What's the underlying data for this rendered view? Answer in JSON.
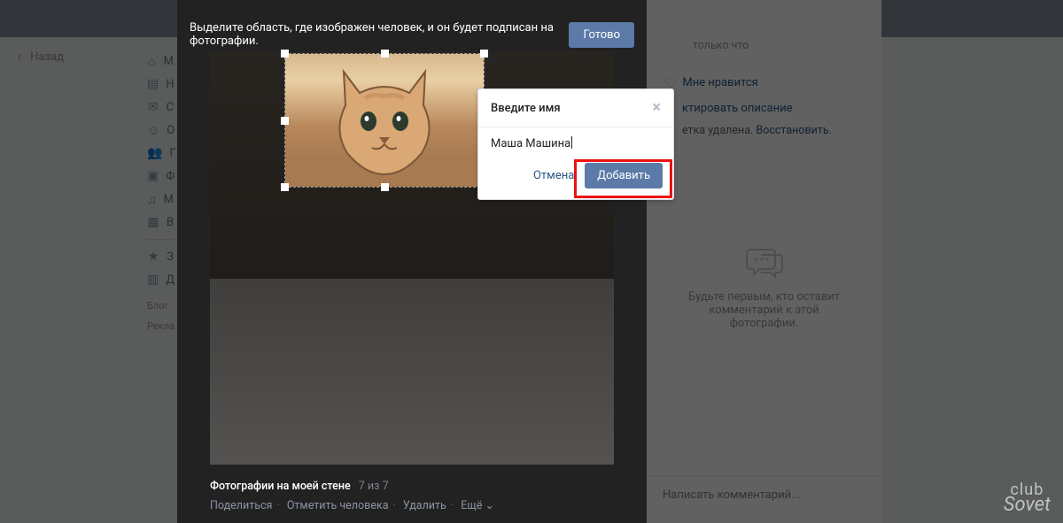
{
  "nav": {
    "back": "Назад"
  },
  "sidebar": {
    "items": [
      "М",
      "Н",
      "С",
      "О",
      "Г",
      "Ф",
      "М",
      "В"
    ],
    "extra": [
      "З",
      "Д"
    ],
    "blog": "Блог",
    "ads": "Рекла"
  },
  "viewer": {
    "hint": "Выделите область, где изображен человек, и он будет подписан на фотографии.",
    "done": "Готово",
    "album_label": "Фотографии на моей стене",
    "counter": "7 из 7",
    "actions": {
      "share": "Поделиться",
      "tag": "Отметить человека",
      "delete": "Удалить",
      "more": "Ещё"
    }
  },
  "popup": {
    "title": "Введите имя",
    "value": "Маша Машина",
    "cancel": "Отмена",
    "add": "Добавить"
  },
  "panel": {
    "time": "только что",
    "like": "Мне нравится",
    "edit_desc": "ктировать описание",
    "tag_deleted": "етка удалена.",
    "restore": "Восстановить",
    "comments_empty1": "Будьте первым, кто оставит",
    "comments_empty2": "комментарий к этой фотографии.",
    "write": "Написать комментарий..."
  },
  "watermark": {
    "line1": "club",
    "line2": "Sovet"
  }
}
